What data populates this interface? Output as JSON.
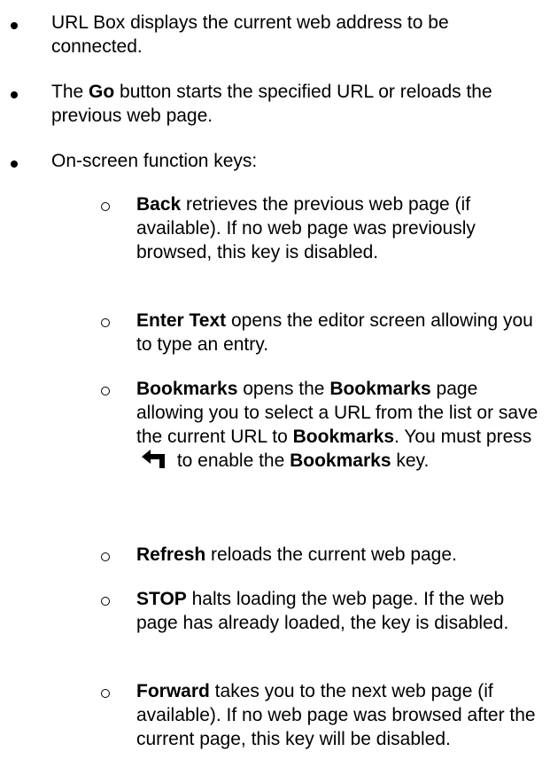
{
  "bullets": [
    {
      "text": "URL Box displays the current web address to be connected."
    },
    {
      "bold": "Go",
      "text": " button starts the specified URL or reloads the previous web page.",
      "prefix": "The "
    },
    {
      "text": "On-screen function keys:"
    }
  ],
  "sub_items": [
    {
      "bold": "Back",
      "text": " retrieves the previous web page (if available). If no web page was previously browsed, this key is disabled."
    },
    {
      "bold": "Enter Text",
      "text": " opens the editor screen allowing you to type an entry."
    },
    {
      "bold": "Bookmarks",
      "mid1": " opens the ",
      "bold2": "Bookmarks",
      "mid2": " page allowing you to select a URL from the list or save the current URL to ",
      "bold3": "Bookmarks",
      "mid3": ". You must press ",
      "icon": "enter-return-icon",
      "mid4": " to enable the ",
      "bold4": "Bookmarks",
      "end": " key."
    },
    {
      "bold": "Refresh",
      "text": " reloads the current web page."
    },
    {
      "bold": "STOP",
      "text": " halts loading the web page. If the web page has already loaded, the key is disabled."
    },
    {
      "bold": "Forward",
      "text": " takes you to the next web page (if available). If no web page was browsed after the current page, this key will be disabled."
    }
  ]
}
